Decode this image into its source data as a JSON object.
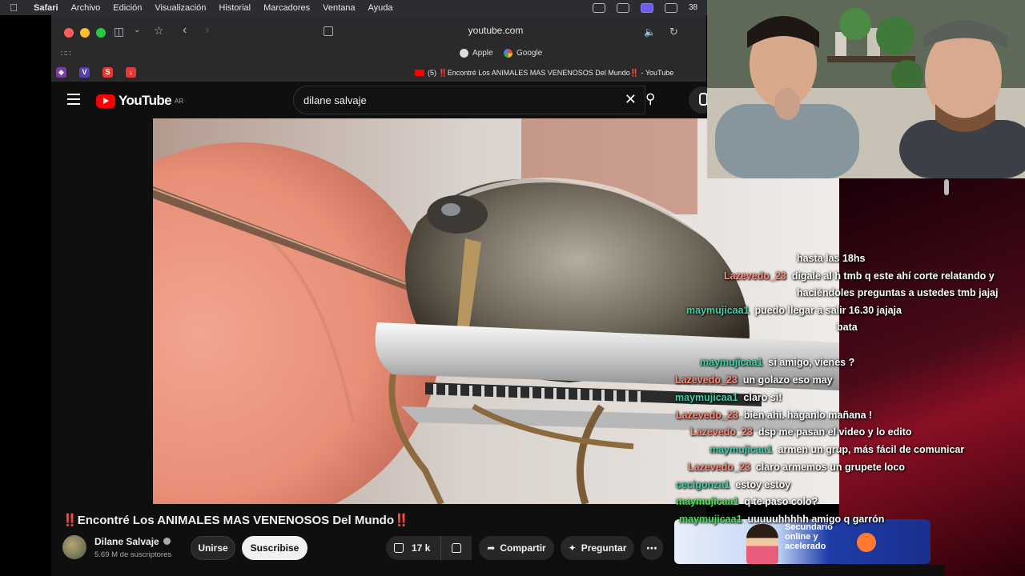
{
  "menubar": {
    "app": "Safari",
    "items": [
      "Archivo",
      "Edición",
      "Visualización",
      "Historial",
      "Marcadores",
      "Ventana",
      "Ayuda"
    ],
    "status_text": "38"
  },
  "browser": {
    "url": "youtube.com",
    "favorites": [
      "Apple",
      "Google"
    ],
    "tab_title": "(5) ‼️Encontré Los ANIMALES MAS VENENOSOS Del Mundo‼️ - YouTube",
    "tab_icons": [
      "V",
      "S"
    ]
  },
  "youtube": {
    "logo_text": "YouTube",
    "region": "AR",
    "search_query": "dilane salvaje",
    "video": {
      "title_marks": "‼️",
      "title": "Encontré Los ANIMALES MAS VENENOSOS Del Mundo",
      "channel": "Dilane Salvaje",
      "subscribers": "5.69 M de suscriptores",
      "join_label": "Unirse",
      "subscribe_label": "Suscribise",
      "likes": "17 k",
      "share_label": "Compartir",
      "ask_label": "Preguntar"
    }
  },
  "chat": {
    "messages": [
      {
        "user": "",
        "text": "hasta las 18hs"
      },
      {
        "user": "Lazevedo_23",
        "text": "digale al h tmb q este ahí corte relatando y"
      },
      {
        "user": "",
        "text": "haciéndoles preguntas a ustedes tmb jajaj"
      },
      {
        "user": "maymujicaa1",
        "text": "puedo llegar a salir 16.30 jajaja"
      },
      {
        "user": "",
        "text": "bata"
      },
      {
        "user": "maymujicaa1",
        "text": "si amigo, vienes ?"
      },
      {
        "user": "Lazevedo_23",
        "text": "un golazo eso may"
      },
      {
        "user": "maymujicaa1",
        "text": "claro si!"
      },
      {
        "user": "Lazevedo_23",
        "text": "bien ahi. háganlo mañana !"
      },
      {
        "user": "Lazevedo_23",
        "text": "dsp me pasan el video y lo edito"
      },
      {
        "user": "maymujicaa1",
        "text": "armen un grup, más fácil de comunicar"
      },
      {
        "user": "Lazevedo_23",
        "text": "claro armemos un grupete loco"
      },
      {
        "user": "cecigonza1",
        "text": "estoy estoy"
      },
      {
        "user": "maymujicaa1",
        "text": "q te paso colo?"
      },
      {
        "user": "maymujicaa1",
        "text": "uuuuuhhhhh amigo q garrón"
      }
    ],
    "ad": {
      "line1": "Secundario",
      "line2": "online y",
      "line3": "acelerado"
    }
  },
  "colors": {
    "youtube_red": "#ff0000",
    "chat_user_teal": "#3ed1a8",
    "chat_user_green": "#4ae05a",
    "chat_user_salmon": "#ff8a7a"
  }
}
